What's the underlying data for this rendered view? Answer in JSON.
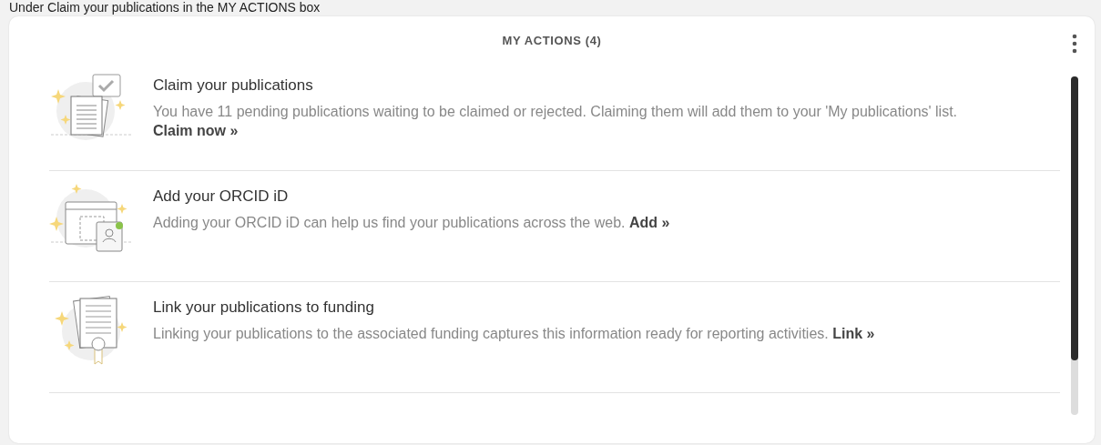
{
  "caption": "Under Claim your publications in the MY ACTIONS box",
  "panel": {
    "title": "MY ACTIONS (4)"
  },
  "actions": [
    {
      "kind": "claim",
      "title": "Claim your publications",
      "description": "You have 11 pending publications waiting to be claimed or rejected. Claiming them will add them to your 'My publications' list.",
      "link": "Claim now »"
    },
    {
      "kind": "orcid",
      "title": "Add your ORCID iD",
      "description": "Adding your ORCID iD can help us find your publications across the web.",
      "link": "Add »"
    },
    {
      "kind": "funding",
      "title": "Link your publications to funding",
      "description": "Linking your publications to the associated funding captures this information ready for reporting activities.",
      "link": "Link »"
    }
  ]
}
